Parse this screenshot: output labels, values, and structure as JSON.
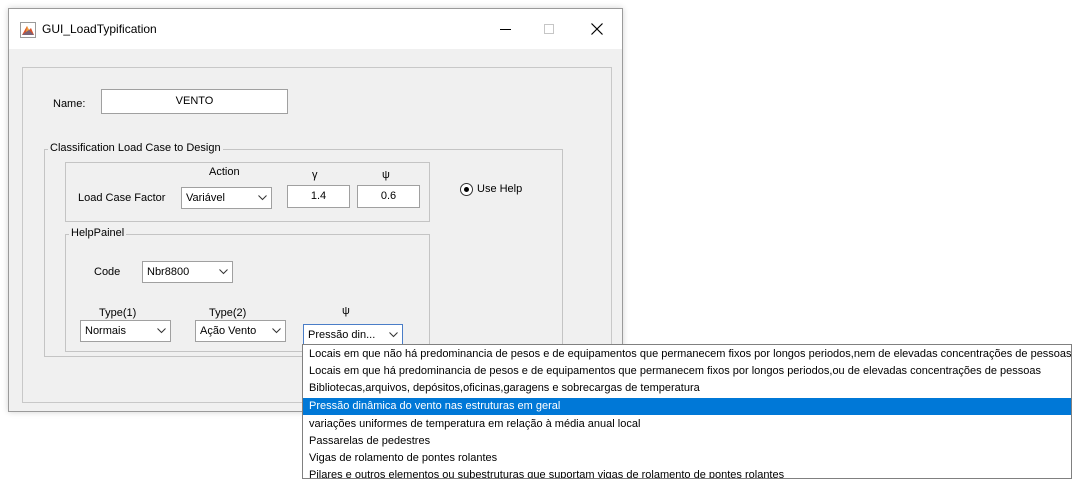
{
  "window": {
    "title": "GUI_LoadTypification",
    "minimize_icon": "minimize-icon",
    "maximize_icon": "maximize-icon",
    "close_icon": "close-icon"
  },
  "name": {
    "label": "Name:",
    "value": "VENTO"
  },
  "classification": {
    "title": "Classification Load Case to Design",
    "action_header": "Action",
    "gamma_header": "γ",
    "psi_header": "ψ",
    "row_label": "Load Case Factor",
    "action_value": "Variável",
    "gamma_value": "1.4",
    "psi_value": "0.6",
    "use_help_label": "Use Help",
    "use_help_selected": true
  },
  "help_panel": {
    "title": "HelpPainel",
    "code_label": "Code",
    "code_value": "Nbr8800",
    "type1_label": "Type(1)",
    "type1_value": "Normais",
    "type2_label": "Type(2)",
    "type2_value": "Ação Vento",
    "psi_label": "ψ",
    "psi_value": "Pressão din..."
  },
  "dropdown": {
    "selected_index": 3,
    "items": [
      "Locais em que não há predominancia de pesos e de equipamentos que permanecem fixos por longos periodos,nem de elevadas concentrações de pessoas",
      "Locais em que há predominancia de pesos e de equipamentos que permanecem fixos por longos periodos,ou de elevadas concentrações de pessoas",
      "Bibliotecas,arquivos, depósitos,oficinas,garagens e sobrecargas de temperatura",
      "Pressão dinâmica do vento nas estruturas em geral",
      "variações uniformes de temperatura em relação à média anual local",
      "Passarelas de pedestres",
      "Vigas de rolamento de pontes rolantes",
      "Pilares e outros elementos ou subestruturas que suportam vigas de rolamento de pontes rolantes"
    ]
  },
  "colors": {
    "selection": "#0078d7",
    "window_bg": "#f0f0f0",
    "focus_border": "#4a7dc7"
  }
}
